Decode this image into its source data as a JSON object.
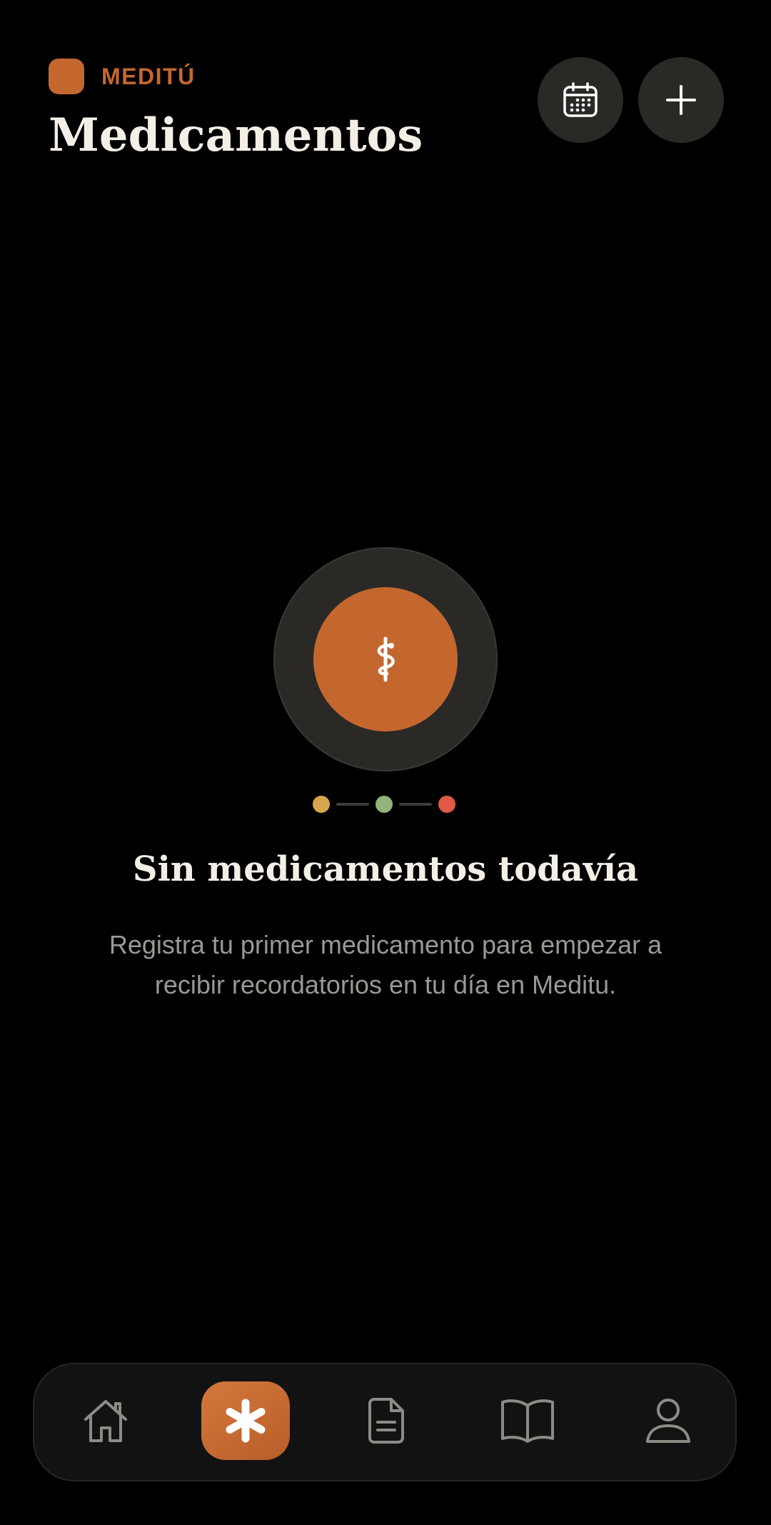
{
  "header": {
    "brand_name": "MEDITÚ",
    "title": "Medicamentos",
    "actions": [
      {
        "name": "calendar-button",
        "icon": "calendar-icon"
      },
      {
        "name": "add-button",
        "icon": "plus-icon"
      }
    ]
  },
  "empty_state": {
    "icon": "caduceus-icon",
    "title": "Sin medicamentos todavía",
    "description": "Registra tu primer medicamento para empezar a recibir recordatorios en tu día en Meditu.",
    "status_dots": [
      "#d5a64e",
      "#91b47a",
      "#e05a45"
    ]
  },
  "tab_bar": {
    "items": [
      {
        "name": "home",
        "icon": "home-icon",
        "active": false
      },
      {
        "name": "medications",
        "icon": "asterisk-icon",
        "active": true
      },
      {
        "name": "documents",
        "icon": "document-icon",
        "active": false
      },
      {
        "name": "library",
        "icon": "book-icon",
        "active": false
      },
      {
        "name": "profile",
        "icon": "user-icon",
        "active": false
      }
    ]
  },
  "colors": {
    "background": "#000000",
    "accent": "#c4672f",
    "surface": "#2a2925",
    "title_text": "#f4efe6",
    "muted_text": "#9a9892",
    "tab_bar": "#121212"
  }
}
